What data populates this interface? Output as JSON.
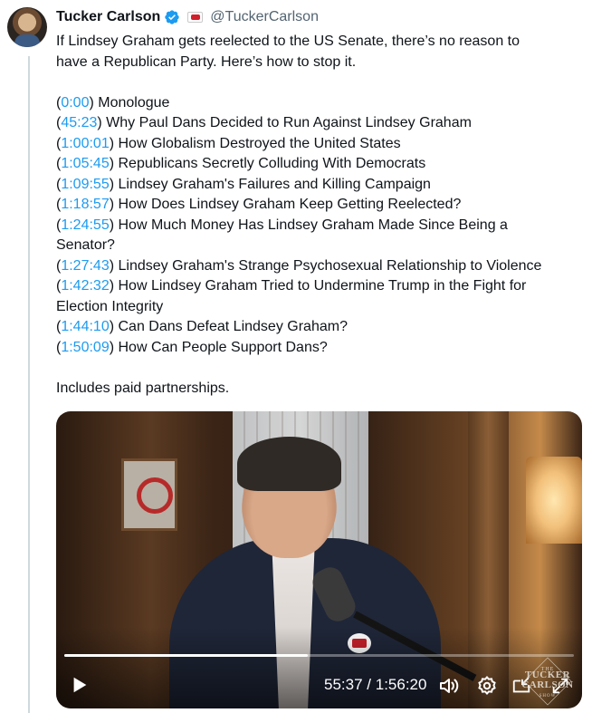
{
  "author": {
    "name": "Tucker Carlson",
    "handle": "@TuckerCarlson",
    "verified_color": "#1d9bf0"
  },
  "tweet": {
    "intro_line1": "If Lindsey Graham gets reelected to the US Senate, there’s no reason to",
    "intro_line2": "have a Republican Party. Here’s how to stop it.",
    "chapters": [
      {
        "time": "0:00",
        "title": "Monologue"
      },
      {
        "time": "45:23",
        "title": "Why Paul Dans Decided to Run Against Lindsey Graham"
      },
      {
        "time": "1:00:01",
        "title": "How Globalism Destroyed the United States"
      },
      {
        "time": "1:05:45",
        "title": "Republicans Secretly Colluding With Democrats"
      },
      {
        "time": "1:09:55",
        "title": "Lindsey Graham's Failures and Killing Campaign"
      },
      {
        "time": "1:18:57",
        "title": "How Does Lindsey Graham Keep Getting Reelected?"
      },
      {
        "time": "1:24:55",
        "title": "How Much Money Has Lindsey Graham Made Since Being a",
        "title_cont": "Senator?"
      },
      {
        "time": "1:27:43",
        "title": "Lindsey Graham's Strange Psychosexual Relationship to Violence"
      },
      {
        "time": "1:42:32",
        "title": "How Lindsey Graham Tried to Undermine Trump in the Fight for",
        "title_cont": "Election Integrity"
      },
      {
        "time": "1:44:10",
        "title": "Can Dans Defeat Lindsey Graham?"
      },
      {
        "time": "1:50:09",
        "title": "How Can People Support Dans?"
      }
    ],
    "disclosure": "Includes paid partnerships.",
    "link_color": "#1d9bf0"
  },
  "video": {
    "current_time": "55:37",
    "separator": "/",
    "duration": "1:56:20",
    "progress_fraction": 0.478,
    "watermark": {
      "the": "THE",
      "line1": "TUCKER",
      "line2": "CARLSON",
      "show": "SHOW"
    },
    "controls": {
      "play_icon": "play-icon",
      "volume_icon": "volume-icon",
      "settings_icon": "gear-icon",
      "pip_icon": "pip-icon",
      "fullscreen_icon": "fullscreen-icon"
    }
  }
}
